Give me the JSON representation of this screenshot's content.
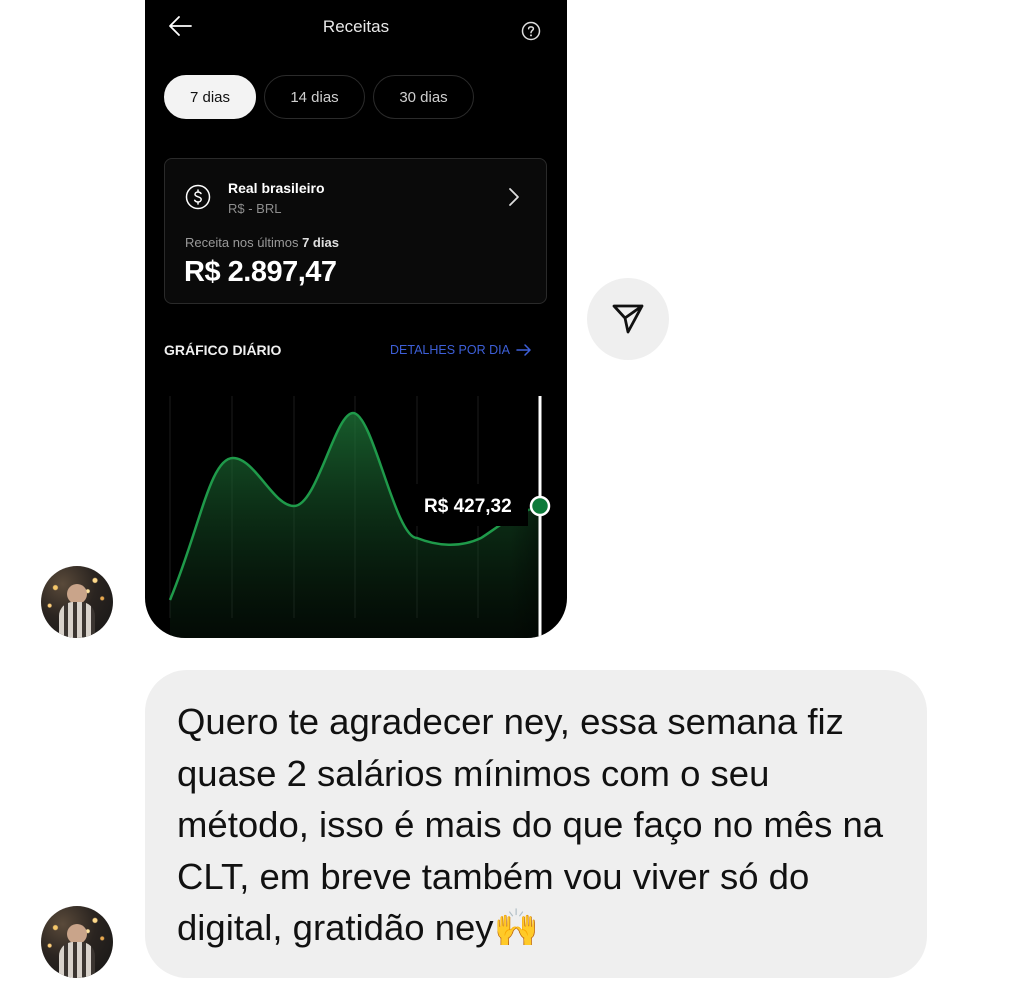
{
  "screen": {
    "title": "Receitas",
    "tabs": [
      "7 dias",
      "14 dias",
      "30 dias"
    ],
    "active_tab": "7 dias",
    "currency": {
      "name": "Real brasileiro",
      "code": "R$ - BRL"
    },
    "period": {
      "prefix": "Receita nos últimos",
      "highlight": "7 dias"
    },
    "revenue": "R$ 2.897,47",
    "section_title": "GRÁFICO DIÁRIO",
    "details_link": "DETALHES POR DIA",
    "tooltip": "R$ 427,32",
    "colors": {
      "accent_green": "#1f9a4a",
      "link_blue": "#3d5fd8"
    }
  },
  "message": {
    "text": "Quero te agradecer ney, essa semana fiz quase 2 salários mínimos com o seu método, isso é mais do que faço no mês na CLT, em breve também vou viver só do digital, gratidão ney🙌"
  }
}
